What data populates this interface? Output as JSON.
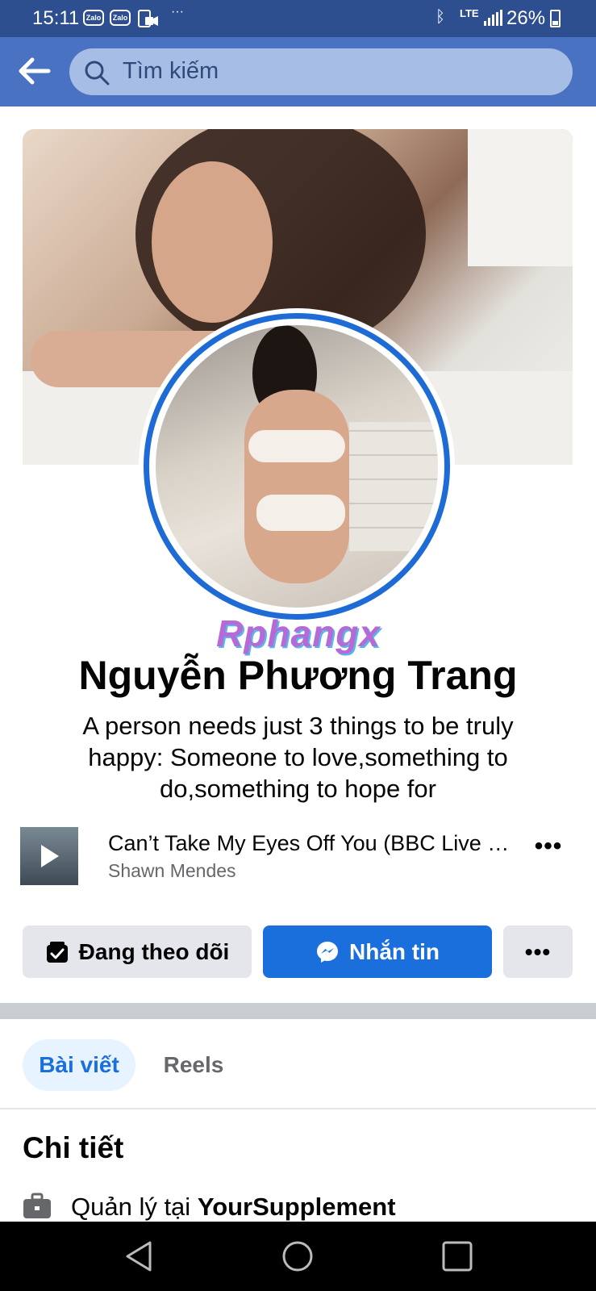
{
  "status_bar": {
    "time": "15:11",
    "notif_1": "Zalo",
    "notif_2": "Zalo",
    "more": "···",
    "network": "LTE",
    "battery": "26%"
  },
  "search": {
    "placeholder": "Tìm kiếm"
  },
  "watermark": "Rphangx",
  "profile": {
    "name": "Nguyễn Phương Trang",
    "bio": "A person needs just 3 things to be truly happy: Someone to love,something to do,something to hope for"
  },
  "music": {
    "title": "Can’t Take My Eyes Off You (BBC Live Lounge)",
    "artist": "Shawn Mendes",
    "more": "•••"
  },
  "actions": {
    "follow_label": "Đang theo dõi",
    "message_label": "Nhắn tin",
    "more_label": "•••"
  },
  "tabs": [
    {
      "label": "Bài viết",
      "active": true
    },
    {
      "label": "Reels",
      "active": false
    }
  ],
  "details": {
    "title": "Chi tiết",
    "work_prefix": "Quản lý tại ",
    "work_place": "YourSupplement"
  },
  "colors": {
    "status_bar": "#2d4f8f",
    "nav": "#4a72c2",
    "accent": "#1b6fdd"
  },
  "icons": [
    "back-arrow-icon",
    "search-icon",
    "play-icon",
    "follow-check-icon",
    "messenger-icon",
    "briefcase-icon",
    "nav-back-icon",
    "nav-home-icon",
    "nav-recents-icon"
  ]
}
